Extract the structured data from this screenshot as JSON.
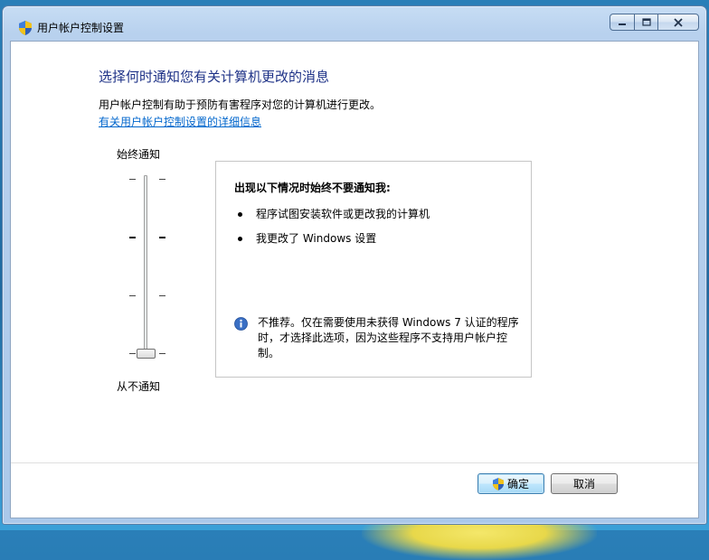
{
  "window": {
    "title": "用户帐户控制设置",
    "title_icon": "uac-shield-icon",
    "caption_buttons": [
      "minimize-icon",
      "maximize-icon",
      "close-icon"
    ]
  },
  "content": {
    "heading": "选择何时通知您有关计算机更改的消息",
    "description": "用户帐户控制有助于预防有害程序对您的计算机进行更改。",
    "link": "有关用户帐户控制设置的详细信息"
  },
  "slider": {
    "top_label": "始终通知",
    "bottom_label": "从不通知",
    "levels": 4,
    "selected_level": 1
  },
  "info_box": {
    "title": "出现以下情况时始终不要通知我:",
    "bullets": [
      "程序试图安装软件或更改我的计算机",
      "我更改了 Windows 设置"
    ],
    "note_icon": "info-icon",
    "note": "不推荐。仅在需要使用未获得 Windows 7 认证的程序时，才选择此选项，因为这些程序不支持用户帐户控制。"
  },
  "buttons": {
    "ok": "确定",
    "cancel": "取消"
  },
  "colors": {
    "heading": "#1e3287",
    "link": "#0066cc",
    "ok_border": "#3c7fb1"
  }
}
